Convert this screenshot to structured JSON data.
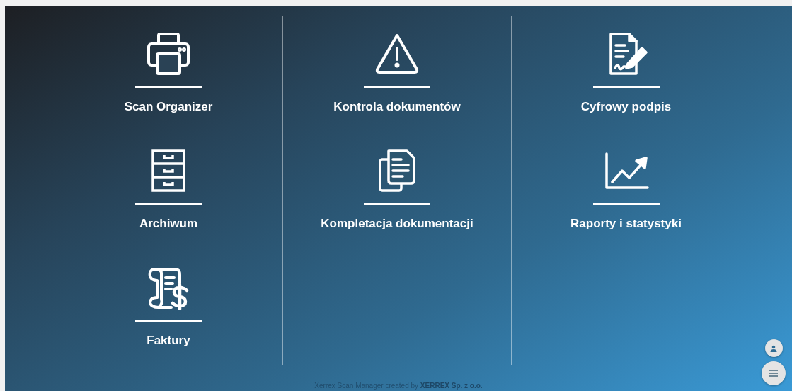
{
  "tiles": [
    {
      "kind": "printer",
      "label": "Scan Organizer"
    },
    {
      "kind": "warning",
      "label": "Kontrola dokumentów"
    },
    {
      "kind": "signature",
      "label": "Cyfrowy podpis"
    },
    {
      "kind": "cabinet",
      "label": "Archiwum"
    },
    {
      "kind": "copies",
      "label": "Kompletacja dokumentacji"
    },
    {
      "kind": "chart",
      "label": "Raporty i statystyki"
    },
    {
      "kind": "invoice",
      "label": "Faktury"
    }
  ],
  "footer": "Xerrex Scan Manager created by **XERREX Sp. z o.o.**",
  "fab_buttons": [
    {
      "kind": "user"
    },
    {
      "kind": "menu"
    }
  ]
}
